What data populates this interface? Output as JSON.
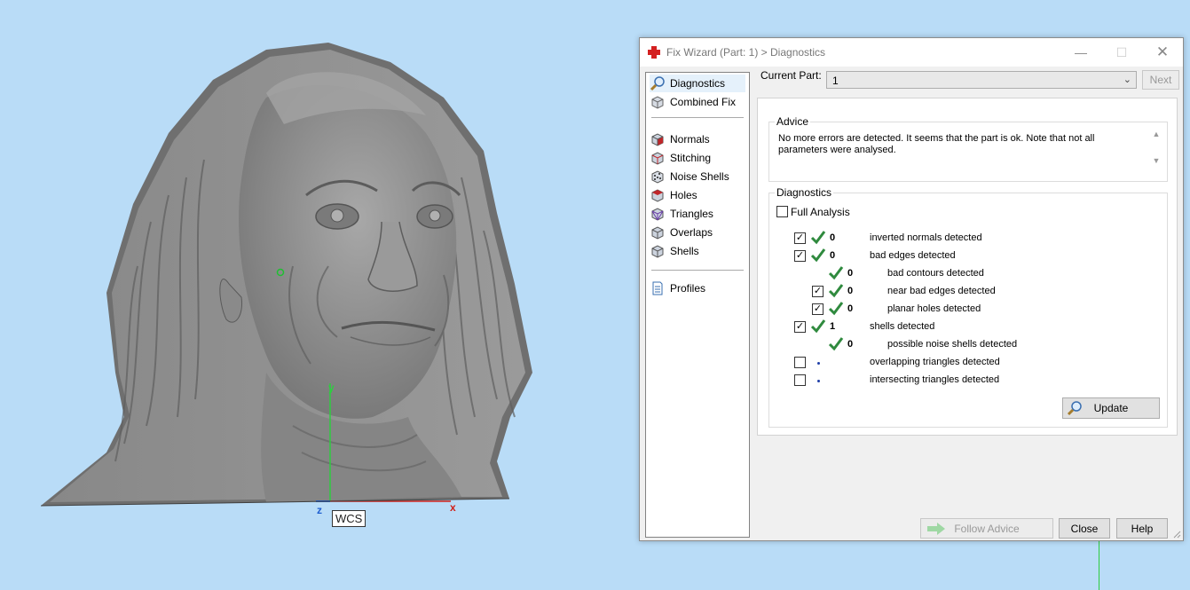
{
  "viewport": {
    "wcs_label": "WCS",
    "axis_y": "y",
    "axis_z": "z",
    "axis_x": "x"
  },
  "window": {
    "title": "Fix Wizard (Part: 1) > Diagnostics",
    "minimize": "—",
    "maximize": "☐",
    "close": "✕"
  },
  "nav": {
    "items": [
      {
        "label": "Diagnostics",
        "icon": "magnifier-icon"
      },
      {
        "label": "Combined Fix",
        "icon": "cube-icon"
      },
      {
        "label": "Normals",
        "icon": "normals-cube-icon"
      },
      {
        "label": "Stitching",
        "icon": "stitching-cube-icon"
      },
      {
        "label": "Noise Shells",
        "icon": "noise-shells-icon"
      },
      {
        "label": "Holes",
        "icon": "holes-cube-icon"
      },
      {
        "label": "Triangles",
        "icon": "triangles-cube-icon"
      },
      {
        "label": "Overlaps",
        "icon": "overlaps-cube-icon"
      },
      {
        "label": "Shells",
        "icon": "shells-cube-icon"
      },
      {
        "label": "Profiles",
        "icon": "document-icon"
      }
    ]
  },
  "toolbar": {
    "current_part_label": "Current Part:",
    "current_part_value": "1",
    "next_label": "Next"
  },
  "advice": {
    "title": "Advice",
    "text": "No more errors are detected. It seems that the part is ok. Note that not all parameters were analysed."
  },
  "diagnostics": {
    "title": "Diagnostics",
    "full_analysis_label": "Full Analysis",
    "rows": [
      {
        "checked": true,
        "status": "ok",
        "count": "0",
        "label": "inverted normals detected"
      },
      {
        "checked": true,
        "status": "ok",
        "count": "0",
        "label": "bad edges detected"
      },
      {
        "checked": null,
        "status": "ok",
        "count": "0",
        "label": "bad contours detected"
      },
      {
        "checked": true,
        "status": "ok",
        "count": "0",
        "label": "near bad edges detected"
      },
      {
        "checked": true,
        "status": "ok",
        "count": "0",
        "label": "planar holes detected"
      },
      {
        "checked": true,
        "status": "ok",
        "count": "1",
        "label": "shells detected"
      },
      {
        "checked": null,
        "status": "ok",
        "count": "0",
        "label": "possible noise shells detected"
      },
      {
        "checked": false,
        "status": "none",
        "count": "",
        "label": "overlapping triangles detected"
      },
      {
        "checked": false,
        "status": "none",
        "count": "",
        "label": "intersecting triangles detected"
      }
    ],
    "update_label": "Update"
  },
  "footer": {
    "follow_advice_label": "Follow Advice",
    "close_label": "Close",
    "help_label": "Help"
  },
  "colors": {
    "background": "#b9dcf7",
    "check_green": "#2f8a3e",
    "y_axis": "#2ecc40",
    "x_axis": "#d0201a",
    "z_axis": "#1f5fd0",
    "model_gray": "#8c8c8c"
  }
}
